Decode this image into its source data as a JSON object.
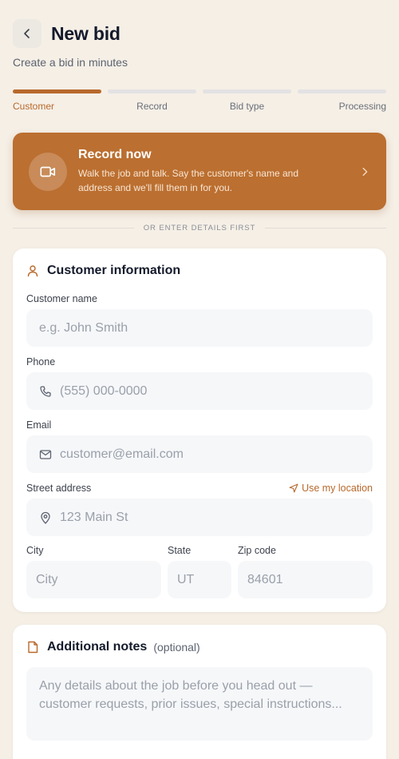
{
  "header": {
    "title": "New bid",
    "subtitle": "Create a bid in minutes"
  },
  "steps": [
    {
      "label": "Customer",
      "active": true
    },
    {
      "label": "Record",
      "active": false
    },
    {
      "label": "Bid type",
      "active": false
    },
    {
      "label": "Processing",
      "active": false
    }
  ],
  "record": {
    "title": "Record now",
    "description": "Walk the job and talk. Say the customer's name and address and we'll fill them in for you."
  },
  "divider": "OR ENTER DETAILS FIRST",
  "customer": {
    "title": "Customer information",
    "name": {
      "label": "Customer name",
      "placeholder": "e.g. John Smith",
      "value": ""
    },
    "phone": {
      "label": "Phone",
      "placeholder": "(555) 000-0000",
      "value": ""
    },
    "email": {
      "label": "Email",
      "placeholder": "customer@email.com",
      "value": ""
    },
    "street": {
      "label": "Street address",
      "placeholder": "123 Main St",
      "value": ""
    },
    "use_location": "Use my location",
    "city": {
      "label": "City",
      "placeholder": "City",
      "value": ""
    },
    "state": {
      "label": "State",
      "placeholder": "UT",
      "value": ""
    },
    "zip": {
      "label": "Zip code",
      "placeholder": "84601",
      "value": ""
    }
  },
  "notes": {
    "title": "Additional notes",
    "optional": "(optional)",
    "placeholder": "Any details about the job before you head out — customer requests, prior issues, special instructions..."
  },
  "colors": {
    "accent": "#b8692c",
    "background": "#f5efe6"
  },
  "icons": {
    "back": "chevron-left-icon",
    "record": "video-camera-icon",
    "record_chevron": "chevron-right-icon",
    "customer": "user-icon",
    "phone": "phone-icon",
    "email": "mail-icon",
    "street": "map-pin-icon",
    "use_location": "navigation-arrow-icon",
    "notes": "note-icon"
  }
}
